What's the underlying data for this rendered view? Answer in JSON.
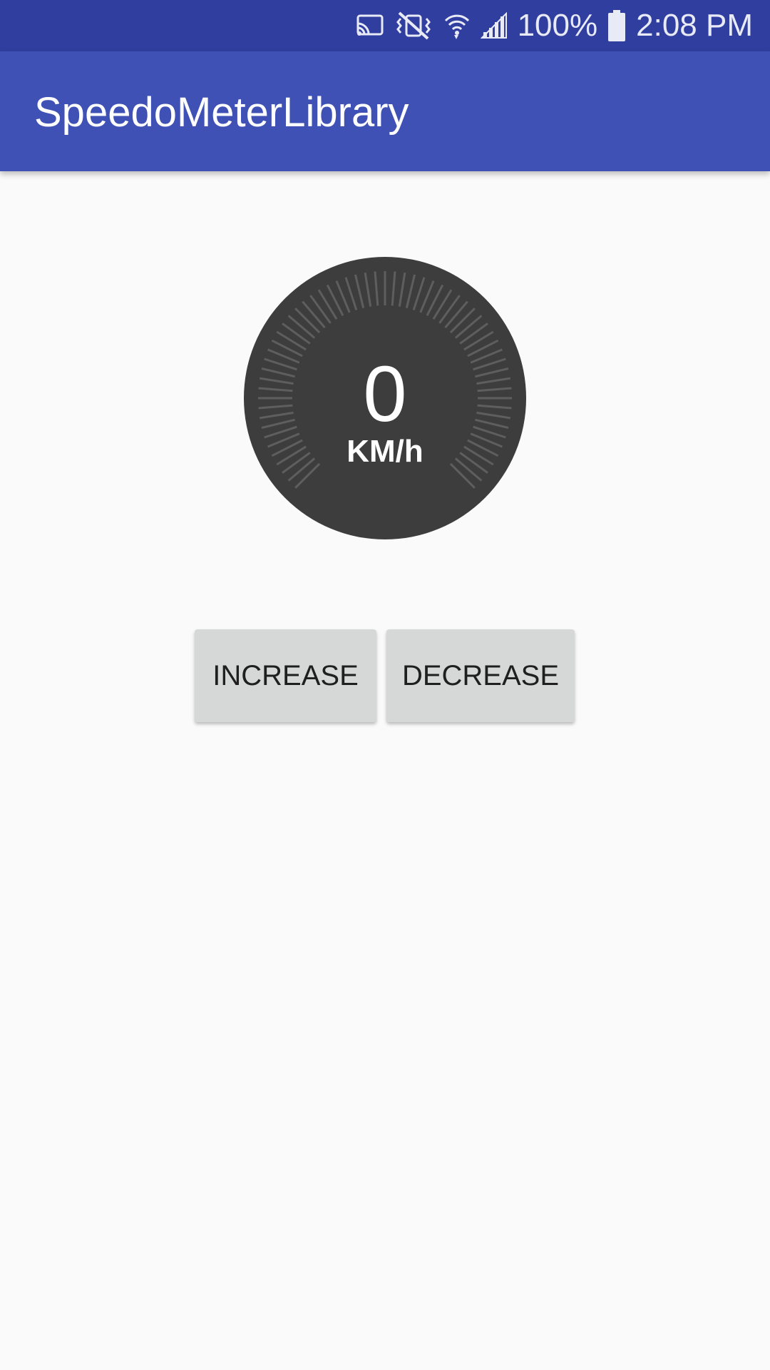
{
  "status_bar": {
    "battery_text": "100%",
    "time": "2:08 PM",
    "icons": [
      "cast-icon",
      "vibrate-mute-icon",
      "wifi-icon",
      "signal-icon",
      "battery-icon"
    ]
  },
  "app_bar": {
    "title": "SpeedoMeterLibrary"
  },
  "speedometer": {
    "value": "0",
    "unit": "KM/h",
    "speed": 0,
    "dial_color": "#3d3d3d",
    "tick_color": "#5e5e5e"
  },
  "buttons": {
    "increase_label": "INCREASE",
    "decrease_label": "DECREASE"
  },
  "colors": {
    "status_bar": "#303f9f",
    "app_bar": "#3f51b5",
    "background": "#fafafa",
    "button": "#d6d7d7"
  }
}
